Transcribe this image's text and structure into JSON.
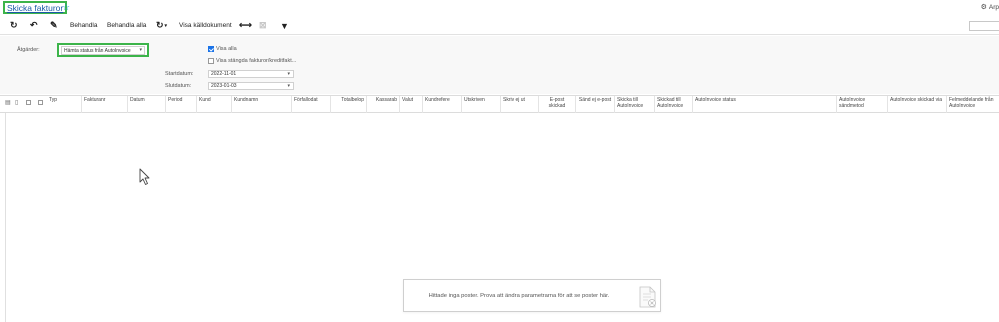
{
  "header": {
    "title": "Skicka fakturor",
    "top_right_label": "Arp"
  },
  "toolbar": {
    "refresh_icon": "refresh-icon",
    "undo_icon": "undo-icon",
    "edit_icon": "pencil-icon",
    "behandla_label": "Behandla",
    "behandla_alla_label": "Behandla alla",
    "sync_icon": "sync-dropdown-icon",
    "visa_kalldokument_label": "Visa källdokument",
    "fit_icon": "fit-columns-icon",
    "export_icon": "export-icon",
    "filter_icon": "filter-icon"
  },
  "filter": {
    "atgarder_label": "Åtgärder:",
    "atgarder_value": "Hämta status från AutoInvoice",
    "visa_alla_label": "Visa alla",
    "visa_alla_checked": true,
    "visa_stangda_label": "Visa stängda fakturor/kreditfakt...",
    "visa_stangda_checked": false,
    "startdatum_label": "Startdatum:",
    "startdatum_value": "2022-11-01",
    "slutdatum_label": "Slutdatum:",
    "slutdatum_value": "2023-01-03"
  },
  "columns": [
    "Typ",
    "Fakturanr",
    "Datum",
    "Period",
    "Kund",
    "Kundnamn",
    "Förfallodat",
    "Totalbelop",
    "Kassarab",
    "Valut",
    "Kundrefere",
    "Utskriven",
    "Skriv ej ut",
    "E-post skickad",
    "Sänd ej e-post",
    "Skicka till AutoInvoice",
    "Skickad till AutoInvoice",
    "AutoInvoice status",
    "AutoInvoice sändmetod",
    "AutoInvoice skickad via",
    "Felmeddelande från AutoInvoice"
  ],
  "empty_state": {
    "message": "Hittade inga poster. Prova att ändra parametrarna för att se poster här."
  },
  "colors": {
    "highlight": "#3cb44a",
    "link": "#1a5aa6",
    "checkbox": "#1a73e8"
  }
}
